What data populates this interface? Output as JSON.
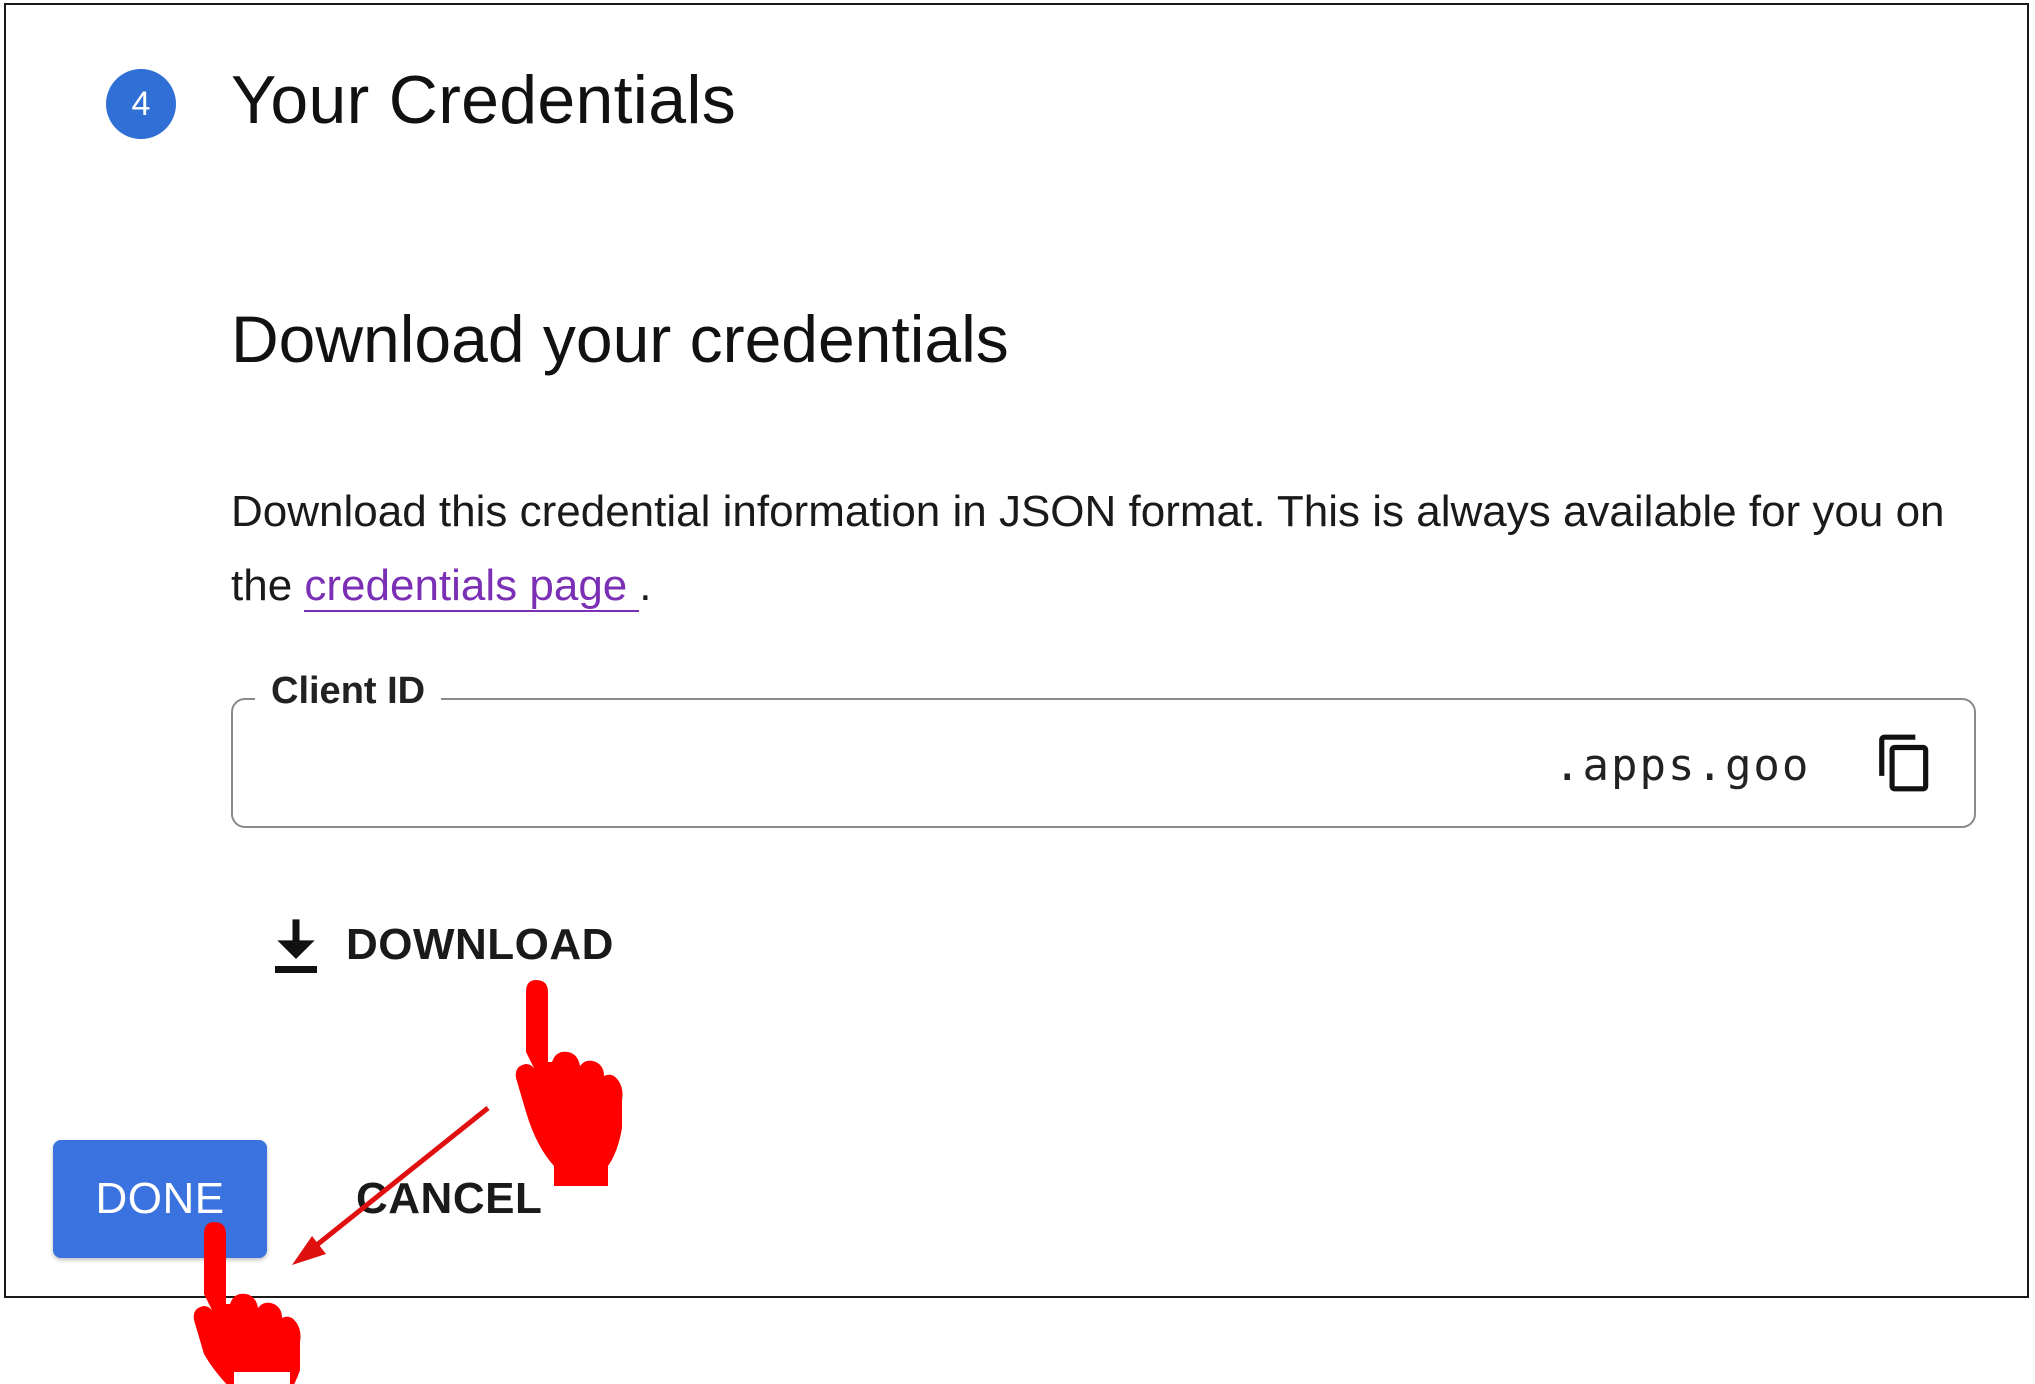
{
  "step": {
    "number": "4",
    "title": "Your Credentials"
  },
  "section": {
    "title": "Download your credentials",
    "description_prefix": "Download this credential information in JSON format. This is always available for you on the ",
    "link_text": "credentials page",
    "description_suffix": "."
  },
  "client_id": {
    "label": "Client ID",
    "value": ".apps.goo"
  },
  "actions": {
    "download_label": "DOWNLOAD",
    "done_label": "DONE",
    "cancel_label": "CANCEL"
  },
  "colors": {
    "accent": "#3a73df",
    "badge": "#2f6fd6",
    "link": "#7b2fb5",
    "pointer": "#ff0000",
    "arrow": "#e01010"
  },
  "icons": {
    "copy": "copy-icon",
    "download": "download-icon",
    "pointer": "hand-pointer-icon",
    "arrow": "arrow-icon"
  }
}
